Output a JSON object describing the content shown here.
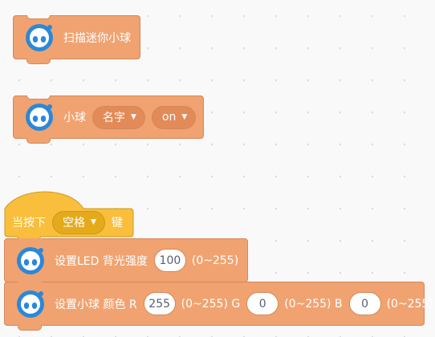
{
  "blocks": {
    "scan": {
      "label": "扫描迷你小球"
    },
    "ball": {
      "label": "小球",
      "name_dropdown": "名字",
      "state_dropdown": "on"
    },
    "key_hat": {
      "label_before": "当按下",
      "key_dropdown": "空格",
      "label_after": "键"
    },
    "led": {
      "label": "设置LED 背光强度",
      "value": "100",
      "range": "(0~255)"
    },
    "color": {
      "label": "设置小球 颜色 R",
      "r_value": "255",
      "r_range": "(0~255) G",
      "g_value": "0",
      "g_range": "(0~255) B",
      "b_value": "0",
      "b_range": "(0~255)"
    }
  },
  "icons": {
    "extension": "sphero-mini-icon",
    "dropdown": "caret-down-icon"
  },
  "colors": {
    "extension_block": "#f0a370",
    "event_block": "#f9be3b",
    "icon_blue": "#2b88d8",
    "input_text": "#575e75"
  }
}
